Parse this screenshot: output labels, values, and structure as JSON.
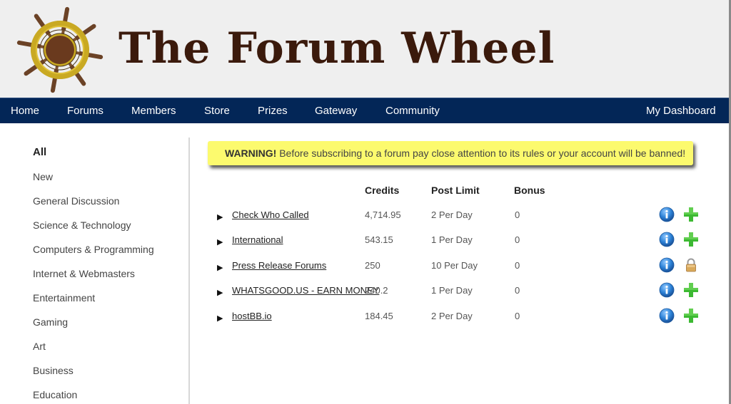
{
  "site": {
    "title": "The Forum Wheel",
    "logo_icon": "ship-wheel-icon"
  },
  "nav": {
    "items": [
      {
        "label": "Home"
      },
      {
        "label": "Forums"
      },
      {
        "label": "Members"
      },
      {
        "label": "Store"
      },
      {
        "label": "Prizes"
      },
      {
        "label": "Gateway"
      },
      {
        "label": "Community"
      }
    ],
    "right_label": "My Dashboard"
  },
  "sidebar": {
    "active": "All",
    "items": [
      {
        "label": "All"
      },
      {
        "label": "New"
      },
      {
        "label": "General Discussion"
      },
      {
        "label": "Science & Technology"
      },
      {
        "label": "Computers & Programming"
      },
      {
        "label": "Internet & Webmasters"
      },
      {
        "label": "Entertainment"
      },
      {
        "label": "Gaming"
      },
      {
        "label": "Art"
      },
      {
        "label": "Business"
      },
      {
        "label": "Education"
      }
    ]
  },
  "warning": {
    "strong": "WARNING!",
    "text": " Before subscribing to a forum pay close attention to its rules or your account will be banned!",
    "background": "#fcfa6e"
  },
  "table": {
    "headers": {
      "credits": "Credits",
      "post_limit": "Post Limit",
      "bonus": "Bonus"
    },
    "rows": [
      {
        "name": "Check Who Called",
        "credits": "4,714.95",
        "post_limit": "2 Per Day",
        "bonus": "0",
        "action_icon": "add-icon",
        "locked": false
      },
      {
        "name": "International",
        "credits": "543.15",
        "post_limit": "1 Per Day",
        "bonus": "0",
        "action_icon": "add-icon",
        "locked": false
      },
      {
        "name": "Press Release Forums",
        "credits": "250",
        "post_limit": "10 Per Day",
        "bonus": "0",
        "action_icon": "lock-icon",
        "locked": true
      },
      {
        "name": "WHATSGOOD.US - EARN MONEY",
        "credits": "240.2",
        "post_limit": "1 Per Day",
        "bonus": "0",
        "action_icon": "add-icon",
        "locked": false
      },
      {
        "name": "hostBB.io",
        "credits": "184.45",
        "post_limit": "2 Per Day",
        "bonus": "0",
        "action_icon": "add-icon",
        "locked": false
      }
    ],
    "arrow_glyph": "▶"
  },
  "colors": {
    "nav_bg": "#032657",
    "header_bg": "#efefef",
    "title_color": "#3b1a0c",
    "add_green": "#3cb932",
    "info_blue": "#2a7fd4"
  }
}
